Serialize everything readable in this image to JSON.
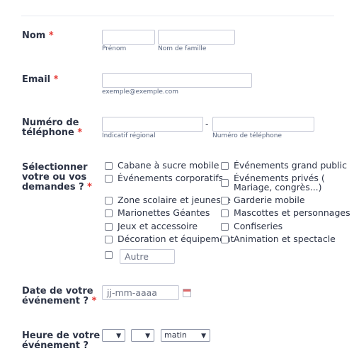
{
  "form": {
    "name": {
      "label": "Nom",
      "required_mark": "*",
      "first_sublabel": "Prénom",
      "last_sublabel": "Nom de famille"
    },
    "email": {
      "label": "Email",
      "required_mark": "*",
      "sublabel": "exemple@exemple.com"
    },
    "phone": {
      "label_line1": "Numéro de",
      "label_line2": "téléphone",
      "required_mark": "*",
      "separator": "-",
      "area_sublabel": "Indicatif régional",
      "number_sublabel": "Numéro de téléphone"
    },
    "requests": {
      "label_line1": "Sélectionner",
      "label_line2": "votre ou vos",
      "label_line3": "demandes ?",
      "required_mark": "*",
      "options_left": [
        "Cabane à sucre mobile",
        "Événements corporatifs",
        "Zone scolaire et jeunesse",
        "Marionettes Géantes",
        "Jeux et accessoire",
        "Décoration et équipement"
      ],
      "options_right": [
        "Événements grand public",
        "Événements privés (",
        "Mariage, congrès...)",
        "Garderie mobile",
        "Mascottes et personnages",
        "Confiseries",
        "Animation et spectacle"
      ],
      "other_placeholder": "Autre"
    },
    "event_date": {
      "label_line1": "Date de votre",
      "label_line2": "événement ?",
      "required_mark": "*",
      "placeholder": "jj-mm-aaaa"
    },
    "event_time": {
      "label_line1": "Heure de votre",
      "label_line2": "événement ?",
      "hour_value": "",
      "minute_value": "",
      "ampm_value": "matin"
    }
  }
}
